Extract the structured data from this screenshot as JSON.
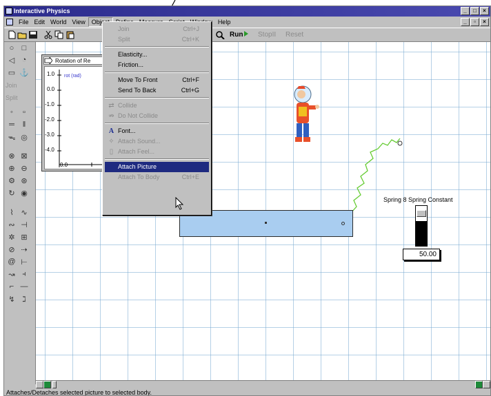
{
  "window": {
    "title": "Interactive Physics"
  },
  "menubar": {
    "items": [
      "File",
      "Edit",
      "World",
      "View",
      "Object",
      "Define",
      "Measure",
      "Script",
      "Window",
      "Help"
    ],
    "active": "Object"
  },
  "toolbar": {
    "run": "Run",
    "stop": "StopII",
    "reset": "Reset"
  },
  "palette": {
    "join": "Join",
    "split": "Split"
  },
  "meter": {
    "title": "Rotation of Re",
    "legend": "rot (rad)",
    "ticks": [
      "1.0",
      "0.0",
      "-1.0",
      "-2.0",
      "-3.0",
      "-4.0"
    ],
    "xtick": "0.0"
  },
  "object_menu": {
    "items": [
      {
        "label": "Join",
        "shortcut": "Ctrl+J",
        "disabled": true,
        "icon": ""
      },
      {
        "label": "Split",
        "shortcut": "Ctrl+K",
        "disabled": true,
        "icon": ""
      },
      {
        "label": "Elasticity...",
        "shortcut": "",
        "disabled": false,
        "icon": ""
      },
      {
        "label": "Friction...",
        "shortcut": "",
        "disabled": false,
        "icon": ""
      },
      {
        "label": "Move To Front",
        "shortcut": "Ctrl+F",
        "disabled": false,
        "icon": ""
      },
      {
        "label": "Send To Back",
        "shortcut": "Ctrl+G",
        "disabled": false,
        "icon": ""
      },
      {
        "label": "Collide",
        "shortcut": "",
        "disabled": true,
        "icon": "collide-icon"
      },
      {
        "label": "Do Not Collide",
        "shortcut": "",
        "disabled": true,
        "icon": "no-collide-icon"
      },
      {
        "label": "Font...",
        "shortcut": "",
        "disabled": false,
        "icon": "font-icon"
      },
      {
        "label": "Attach Sound...",
        "shortcut": "",
        "disabled": true,
        "icon": "sound-icon"
      },
      {
        "label": "Attach Feel...",
        "shortcut": "",
        "disabled": true,
        "icon": "feel-icon"
      },
      {
        "label": "Attach Picture",
        "shortcut": "",
        "disabled": false,
        "icon": "",
        "highlighted": true
      },
      {
        "label": "Attach To Body",
        "shortcut": "Ctrl+E",
        "disabled": true,
        "icon": ""
      }
    ]
  },
  "spring": {
    "label": "Spring 8 Spring Constant",
    "value": "50.00",
    "level": 0.6
  },
  "status": {
    "text": "Attaches/Detaches selected picture to selected body."
  },
  "colors": {
    "titlebar": "#2b2b8c",
    "highlight": "#1e2a80",
    "body": "#a9cdf0",
    "grid": "#78aad2",
    "spring": "#66cc33"
  }
}
